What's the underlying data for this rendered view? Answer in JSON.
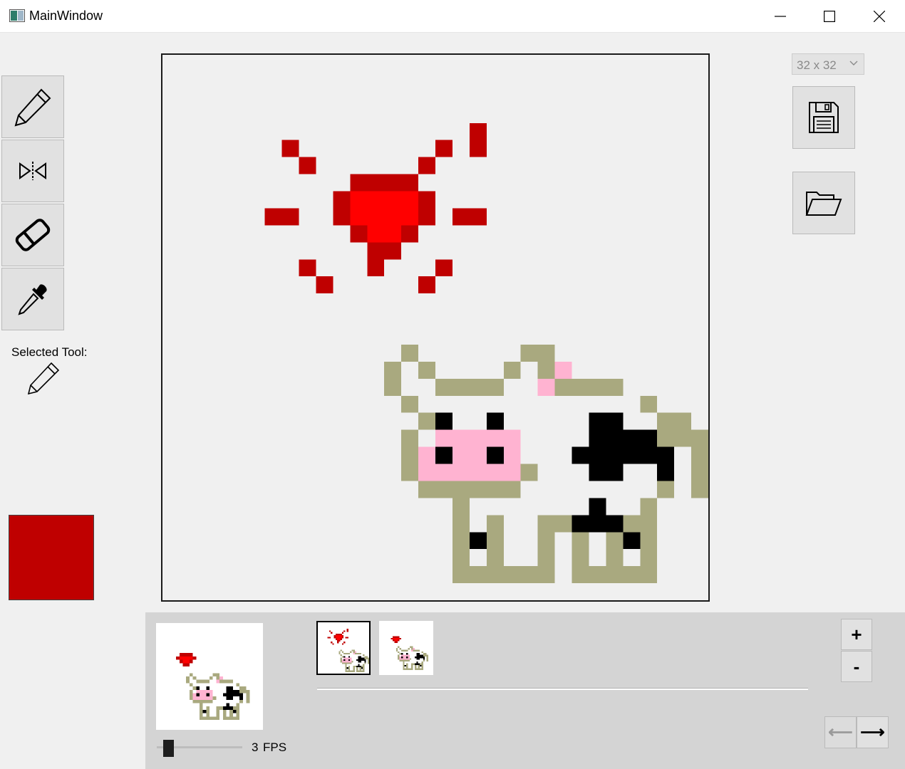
{
  "window": {
    "title": "MainWindow",
    "controls": [
      "minimize-icon",
      "maximize-icon",
      "close-icon"
    ]
  },
  "tools": [
    {
      "name": "pencil",
      "icon": "pencil-icon"
    },
    {
      "name": "mirror",
      "icon": "mirror-icon"
    },
    {
      "name": "eraser",
      "icon": "eraser-icon"
    },
    {
      "name": "eyedropper",
      "icon": "eyedropper-icon"
    }
  ],
  "selected_tool": {
    "label": "Selected Tool:",
    "icon": "pencil-icon"
  },
  "current_color": "#bf0000",
  "canvas_size": {
    "selected": "32 x 32"
  },
  "file_buttons": [
    {
      "name": "save",
      "icon": "floppy-disk-icon"
    },
    {
      "name": "open",
      "icon": "folder-open-icon"
    }
  ],
  "animation": {
    "fps": "3",
    "fps_unit": "FPS",
    "frames_count": 2,
    "selected_frame": 1
  },
  "frame_buttons": {
    "add": "+",
    "remove": "-"
  },
  "nav_buttons": {
    "prev": "⟵",
    "next": "⟶"
  },
  "colors": {
    "heart_dark": "#bf0000",
    "heart_light": "#ff0000",
    "cow_outline": "#a9a97f",
    "cow_pink": "#ffb3d1",
    "cow_black": "#000000"
  }
}
